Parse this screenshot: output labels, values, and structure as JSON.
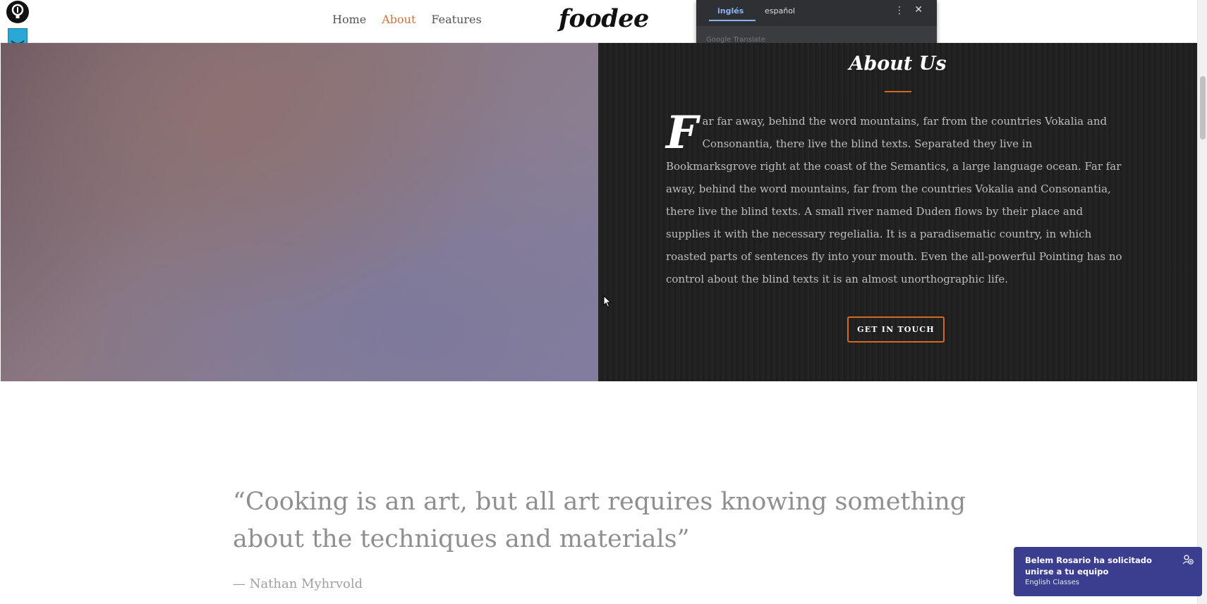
{
  "nav": {
    "items": [
      {
        "label": "Home",
        "active": false
      },
      {
        "label": "About",
        "active": true
      },
      {
        "label": "Features",
        "active": false
      }
    ],
    "brand": "foodee"
  },
  "translate_popup": {
    "tabs": [
      "inglés",
      "español"
    ],
    "selected": "inglés",
    "brand": "Google Translate",
    "menu_icon": "more-vert-icon",
    "close_icon": "close-icon"
  },
  "about": {
    "title": "About Us",
    "dropcap": "F",
    "text": "ar far away, behind the word mountains, far from the countries Vokalia and Consonantia, there live the blind texts. Separated they live in Bookmarksgrove right at the coast of the Semantics, a large language ocean. Far far away, behind the word mountains, far from the countries Vokalia and Consonantia, there live the blind texts. A small river named Duden flows by their place and supplies it with the necessary regelialia. It is a paradisematic country, in which roasted parts of sentences fly into your mouth. Even the all-powerful Pointing has no control about the blind texts it is an almost unorthographic life.",
    "cta": "GET IN TOUCH"
  },
  "quote": {
    "text": "“Cooking is an art, but all art requires knowing something about the techniques and materials”",
    "author": "— Nathan Myhrvold"
  },
  "toast": {
    "message": "Belem Rosario ha solicitado unirse a tu equipo",
    "subtitle": "English Classes",
    "icon": "person-add-icon"
  },
  "colors": {
    "accent": "#d2691e",
    "dark_panel": "#212121",
    "toast_bg": "#3b3d8e"
  }
}
